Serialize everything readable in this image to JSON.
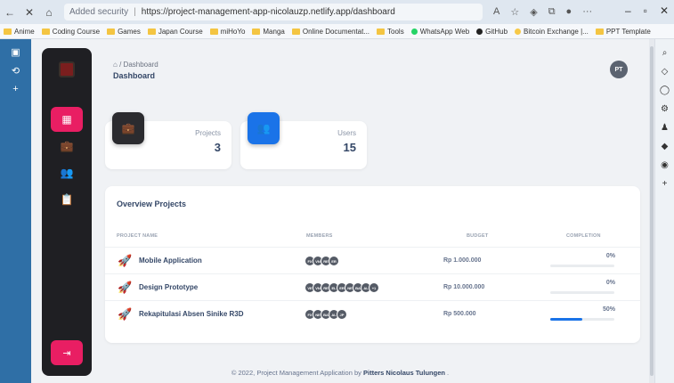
{
  "browser": {
    "security_label": "Added security",
    "url": "https://project-management-app-nicolauzp.netlify.app/dashboard",
    "bookmarks": [
      "Anime",
      "Coding Course",
      "Games",
      "Japan Course",
      "miHoYo",
      "Manga",
      "Online Documentat...",
      "Tools",
      "WhatsApp Web",
      "GitHub",
      "Bitcoin Exchange |...",
      "PPT Template"
    ]
  },
  "header": {
    "breadcrumb_home_icon": "home-icon",
    "breadcrumb_sep": "/",
    "breadcrumb_current": "Dashboard",
    "title": "Dashboard",
    "avatar_initials": "PT"
  },
  "stats": [
    {
      "label": "Projects",
      "value": "3",
      "icon": "briefcase-icon",
      "color": "#2b2b2f"
    },
    {
      "label": "Users",
      "value": "15",
      "icon": "users-icon",
      "color": "#1a73e8"
    }
  ],
  "overview": {
    "title": "Overview Projects",
    "columns": [
      "PROJECT NAME",
      "MEMBERS",
      "BUDGET",
      "COMPLETION"
    ],
    "rows": [
      {
        "name": "Mobile Application",
        "members": [
          "FX",
          "VN",
          "RE",
          "ER"
        ],
        "budget": "Rp 1.000.000",
        "completion": "0%",
        "completion_value": 0
      },
      {
        "name": "Design Prototype",
        "members": [
          "VE",
          "VN",
          "RE",
          "EL",
          "ER",
          "NE",
          "BA",
          "AL",
          "+1"
        ],
        "budget": "Rp 10.000.000",
        "completion": "0%",
        "completion_value": 0
      },
      {
        "name": "Rekapitulasi Absen Sinike R3D",
        "members": [
          "FX",
          "NE",
          "BA",
          "AL",
          "JP"
        ],
        "budget": "Rp 500.000",
        "completion": "50%",
        "completion_value": 50
      }
    ]
  },
  "footer": {
    "text": "© 2022, Project Management Application by",
    "author": "Pitters Nicolaus Tulungen",
    "end": "."
  },
  "colors": {
    "accent": "#e91e63",
    "primary": "#1a73e8",
    "sidebar": "#1f1f23"
  }
}
